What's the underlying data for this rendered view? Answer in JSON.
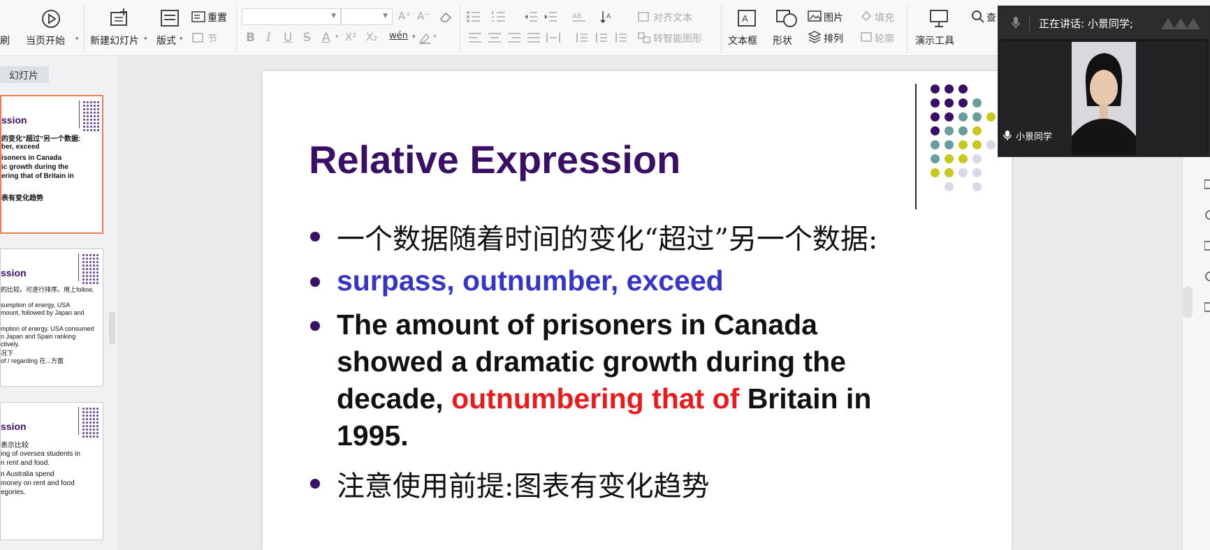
{
  "toolbar": {
    "truncated_left": "刷",
    "play_from_current": "当页开始",
    "new_slide": "新建幻灯片",
    "layout": "版式",
    "reset": "重置",
    "section": "节",
    "bold": "B",
    "italic": "I",
    "underline": "U",
    "strike": "S",
    "font_color": "A",
    "superscript": "X²",
    "subscript": "X₂",
    "phonetic": "wén",
    "grow_font": "A⁺",
    "shrink_font": "A⁻",
    "align_text": "对齐文本",
    "smartart": "转智能图形",
    "textbox": "文本框",
    "shape": "形状",
    "picture": "图片",
    "arrange": "排列",
    "fill": "填充",
    "outline": "轮廓",
    "present_tools": "演示工具",
    "find_truncated": "查"
  },
  "left_panel": {
    "tab_label": "幻灯片",
    "thumbnails": [
      {
        "title": "ssion",
        "lines": [
          {
            "text": "的变化“超过”另一个数据:",
            "color": "#111111"
          },
          {
            "text": "ber, exceed",
            "color": "#3535c8"
          },
          {
            "text": "isoners in Canada",
            "color": "#111111"
          },
          {
            "text": "ic growth during the",
            "color": "#111111"
          },
          {
            "text": "ering that of Britain in",
            "color": "#e81c1c"
          },
          {
            "text": "",
            "color": "#111111"
          },
          {
            "text": "表有变化趋势",
            "color": "#111111"
          }
        ]
      },
      {
        "title": "ssion",
        "lines": [
          {
            "text": "的比较。可进行排序。用上follow,",
            "color": "#111111"
          },
          {
            "text": "",
            "color": "#111111"
          },
          {
            "text": "sumption of energy, USA",
            "color": "#111111"
          },
          {
            "text": "mount, followed by Japan and",
            "color": "#111111"
          },
          {
            "text": "",
            "color": "#111111"
          },
          {
            "text": "mption of energy, USA consumed",
            "color": "#111111"
          },
          {
            "text": "n Japan and Spain ranking",
            "color": "#111111"
          },
          {
            "text": "ctively.",
            "color": "#e81c1c"
          },
          {
            "text": "况下",
            "color": "#111111"
          },
          {
            "text": "of / regarding 在...方面",
            "color": "#111111"
          }
        ]
      },
      {
        "title": "ssion",
        "lines": [
          {
            "text": "表示比较",
            "color": "#111111"
          },
          {
            "text": "ing of oversea students in",
            "color": "#111111"
          },
          {
            "text": "n rent and food.",
            "color": "#111111"
          },
          {
            "text": "n Australia spend",
            "color": "#111111"
          },
          {
            "text": "money on rent and food",
            "color": "#111111"
          },
          {
            "text": "egories.",
            "color": "#111111"
          }
        ]
      }
    ]
  },
  "slide": {
    "title": "Relative Expression",
    "bullet1": "一个数据随着时间的变化“超过”另一个数据:",
    "bullet2": "surpass, outnumber, exceed",
    "bullet3_line1": "The amount of prisoners in Canada",
    "bullet3_line2": "showed a dramatic growth during the",
    "bullet3_line3_a": "decade, ",
    "bullet3_line3_red": "outnumbering that of",
    "bullet3_line3_b": " Britain in",
    "bullet3_line4": "1995.",
    "bullet4": "注意使用前提:图表有变化趋势"
  },
  "video": {
    "speaking": "正在讲话: 小景同学;",
    "name": "小景同学"
  },
  "colors": {
    "title_purple": "#3a0f66",
    "keyword_blue": "#3535c8",
    "highlight_red": "#e81c1c",
    "dot_purple": "#3a0f66",
    "dot_teal": "#6a9e9e",
    "dot_yellow": "#c8c81e",
    "dot_lavender": "#dcd6e8"
  }
}
